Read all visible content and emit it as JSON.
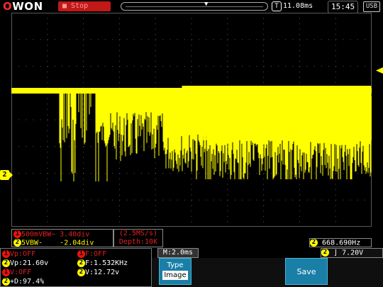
{
  "header": {
    "logo_prefix": "O",
    "logo_rest": "WON",
    "run_state": "Stop",
    "trigger_position": "11.08ms",
    "clock": "15:45",
    "usb": "USB"
  },
  "channel": {
    "marker_label": "2",
    "colors": {
      "ch1": "#e11111",
      "ch2": "#ffff00",
      "trace": "#ffff00",
      "grid": "#5a5a5a"
    }
  },
  "scale": {
    "ch1_icon": "1",
    "ch1_text": "500mVBW~ 3.40div",
    "ch2_icon": "2",
    "ch2_text": "5VBW-    -2.04div",
    "acq_rate": "(2.5MS/s)",
    "acq_depth": "Depth:10K",
    "freq_icon": "2",
    "frequency": "668.690Hz"
  },
  "measurements": {
    "vp1_icon": "1",
    "vp1": "Vp:OFF",
    "f1_icon": "1",
    "f1": "F:OFF",
    "vp2_icon": "2",
    "vp2": "Vp:21.60v",
    "f2_icon": "2",
    "f2": "F:1.532KHz",
    "v1_icon": "1",
    "v1": "V:OFF",
    "v2_icon": "2",
    "v2": "V:12.72v",
    "duty_icon": "2",
    "duty": "+D:97.4%"
  },
  "timebase": "M:2.0ms",
  "trigger": {
    "icon": "2",
    "level": "7.20V"
  },
  "menu": {
    "type_label": "Type",
    "type_value": "Image",
    "save_label": "Save"
  }
}
